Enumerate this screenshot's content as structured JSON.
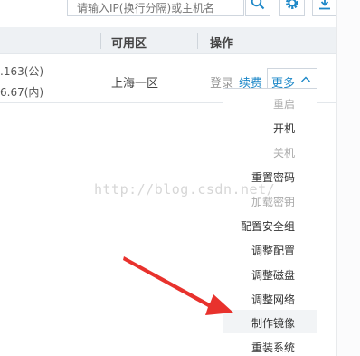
{
  "search": {
    "placeholder": "请输入IP(换行分隔)或主机名"
  },
  "icons": {
    "search": "search-icon",
    "settings": "gear-icon",
    "download": "download-icon"
  },
  "table": {
    "columns": {
      "zone": "可用区",
      "ops": "操作"
    },
    "row": {
      "ip_public": ".163(公)",
      "ip_private": "6.67(内)",
      "zone": "上海一区",
      "login": "登录",
      "renew": "续费",
      "more": "更多"
    }
  },
  "dropdown": {
    "items": [
      {
        "label": "重启",
        "disabled": true
      },
      {
        "label": "开机",
        "disabled": false
      },
      {
        "label": "关机",
        "disabled": true
      },
      {
        "label": "重置密码",
        "disabled": false
      },
      {
        "label": "加载密钥",
        "disabled": true
      },
      {
        "label": "配置安全组",
        "disabled": false
      },
      {
        "label": "调整配置",
        "disabled": false
      },
      {
        "label": "调整磁盘",
        "disabled": false
      },
      {
        "label": "调整网络",
        "disabled": false
      },
      {
        "label": "制作镜像",
        "disabled": false
      },
      {
        "label": "重装系统",
        "disabled": false
      }
    ]
  },
  "watermark": "http://blog.csdn.net/",
  "colors": {
    "link": "#1e88c8",
    "arrow": "#e8322d",
    "header_bg": "#eef1f4"
  }
}
